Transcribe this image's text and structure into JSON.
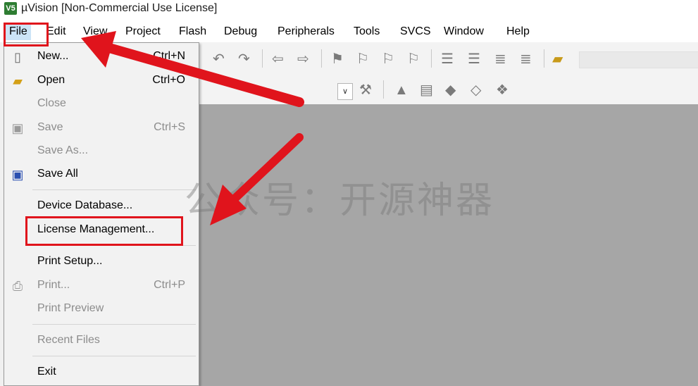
{
  "window": {
    "icon_text": "V5",
    "title": "µVision  [Non-Commercial Use License]"
  },
  "menubar": {
    "items": [
      "File",
      "Edit",
      "View",
      "Project",
      "Flash",
      "Debug",
      "Peripherals",
      "Tools",
      "SVCS",
      "Window",
      "Help"
    ]
  },
  "file_menu": {
    "new": {
      "label": "New...",
      "shortcut": "Ctrl+N"
    },
    "open": {
      "label": "Open",
      "shortcut": "Ctrl+O"
    },
    "close": {
      "label": "Close"
    },
    "save": {
      "label": "Save",
      "shortcut": "Ctrl+S"
    },
    "save_as": {
      "label": "Save As..."
    },
    "save_all": {
      "label": "Save All"
    },
    "device_database": {
      "label": "Device Database..."
    },
    "license_management": {
      "label": "License Management..."
    },
    "print_setup": {
      "label": "Print Setup..."
    },
    "print": {
      "label": "Print...",
      "shortcut": "Ctrl+P"
    },
    "print_preview": {
      "label": "Print Preview"
    },
    "recent_files": {
      "label": "Recent Files"
    },
    "exit": {
      "label": "Exit"
    }
  },
  "watermark": {
    "text": "公众号：开源神器"
  },
  "colors": {
    "highlight": "#e0141c",
    "menu_selected": "#cce4f7",
    "editor_background": "#a6a6a6"
  }
}
